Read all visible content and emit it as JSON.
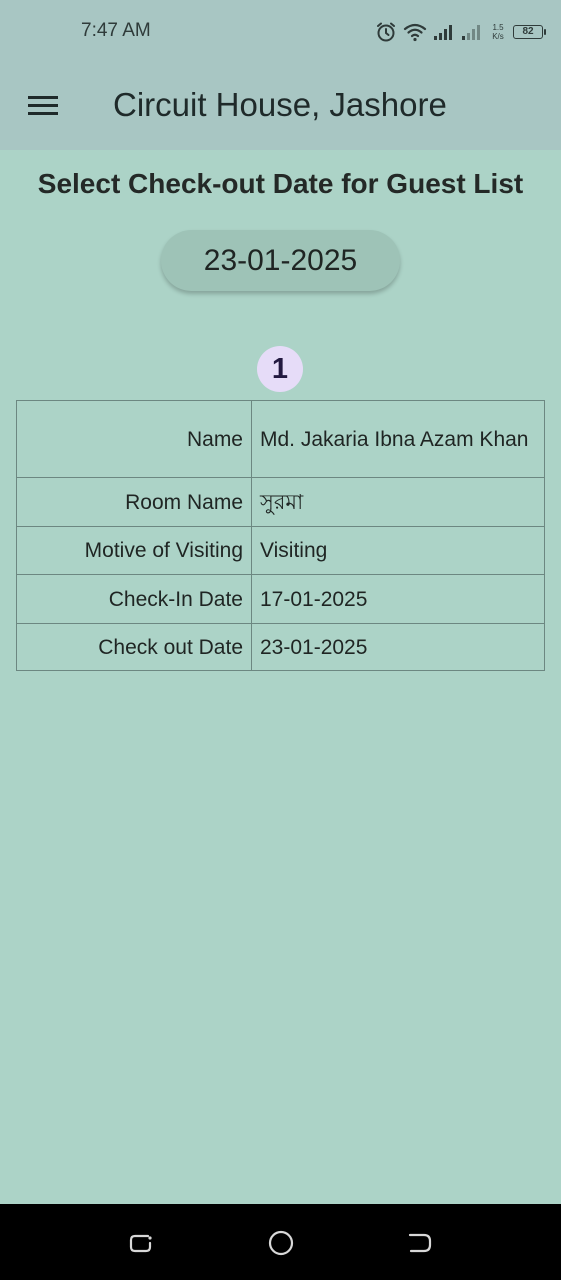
{
  "status_bar": {
    "time": "7:47 AM",
    "net_speed_value": "1.5",
    "net_speed_unit": "K/s",
    "battery_level": "82"
  },
  "app_bar": {
    "title": "Circuit House, Jashore",
    "menu_icon": "hamburger-menu-icon"
  },
  "page": {
    "heading": "Select Check-out Date for Guest List",
    "selected_date": "23-01-2025"
  },
  "guests": [
    {
      "index": "1",
      "fields": [
        {
          "label": "Name",
          "value": "Md. Jakaria Ibna Azam Khan"
        },
        {
          "label": "Room Name",
          "value": "সুরমা"
        },
        {
          "label": "Motive of Visiting",
          "value": "Visiting"
        },
        {
          "label": "Check-In Date",
          "value": "17-01-2025"
        },
        {
          "label": "Check out Date",
          "value": "23-01-2025"
        }
      ]
    }
  ],
  "nav_bar": {
    "icons": [
      "recent-apps-icon",
      "home-icon",
      "back-icon"
    ]
  },
  "colors": {
    "background": "#acd3c7",
    "app_bar": "#a8c6c3",
    "date_button": "#9ec3b7",
    "badge": "#e6dcf8",
    "nav_bar": "#000000"
  }
}
